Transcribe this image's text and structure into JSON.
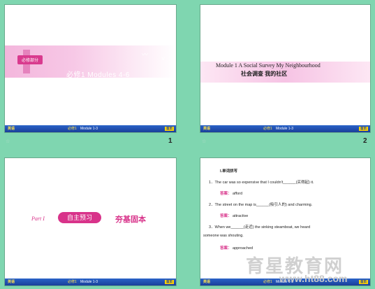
{
  "slides": [
    {
      "badge": "必修部分",
      "title": "必修1    Modules 4-6",
      "footer_left": "英语",
      "footer_mid": "必修1",
      "footer_module": "Module 1-3",
      "footer_right": "首页",
      "page_number": "1"
    },
    {
      "title": "Module 1    A Social Survey    My Neighbourhood",
      "subtitle": "社会调查        我的社区",
      "footer_left": "英语",
      "footer_mid": "必修1",
      "footer_module": "Module 1-3",
      "footer_right": "首页",
      "page_number": "2"
    },
    {
      "script_text": "Part I",
      "nav_button_1": "自主预习",
      "nav_text_2": "夯基固本",
      "footer_left": "英语",
      "footer_mid": "必修1",
      "footer_module": "Module 1-3",
      "footer_right": "首页"
    },
    {
      "heading": "Ⅰ.单词拼写",
      "q1": "1．The car was so expensive that I couldn't______(买得起) it.",
      "a1_label": "答案：",
      "a1": "afford",
      "q2": "2．The street on the map is______(吸引人的) and charming.",
      "a2_label": "答案：",
      "a2": "attractive",
      "q3": "3．When we______(走近) the sinking steamboat, we heard",
      "q3b": "someone was shouting.",
      "a3_label": "答案：",
      "a3": "approached",
      "footer_left": "英语",
      "footer_mid": "必修1",
      "footer_module": "Module 1-3",
      "footer_right": "首页"
    }
  ],
  "watermark": "育星教育网",
  "watermark_url": "www.ht88.com"
}
